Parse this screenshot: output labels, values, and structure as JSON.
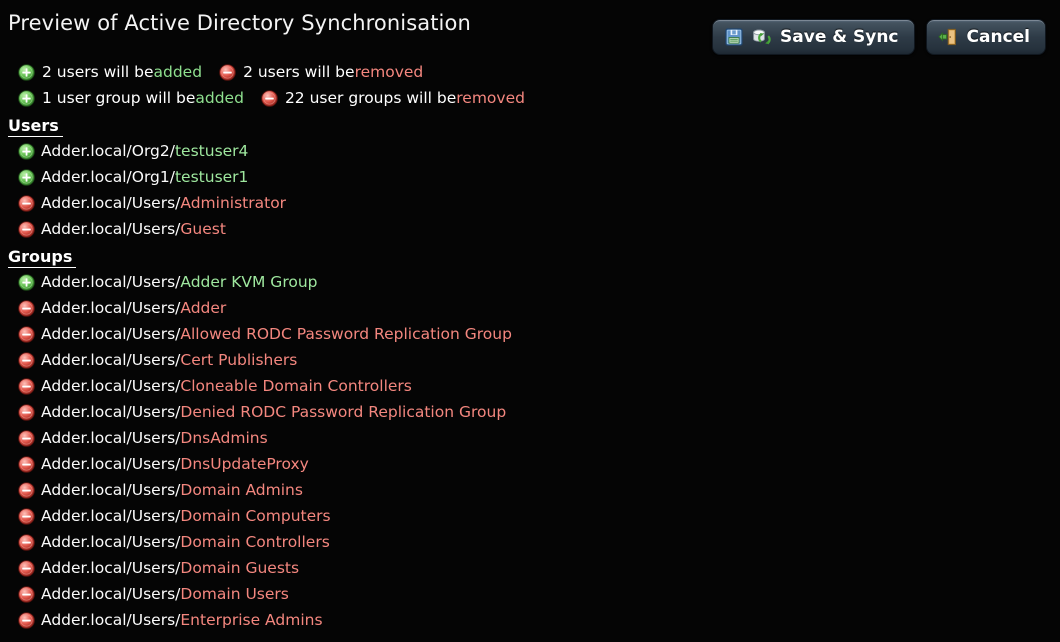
{
  "window": {
    "background_color": "#050505",
    "title": "Preview of Active Directory Synchronisation"
  },
  "colors": {
    "added": "#9fe89f",
    "removed": "#f4877f",
    "text": "#fbfbfb",
    "button_face": "#2e3b47"
  },
  "header": {
    "title": "Preview of Active Directory Synchronisation",
    "buttons": [
      {
        "label": "Save & Sync",
        "name": "save-and-sync-button",
        "icons": [
          "save-floppy-icon",
          "sync-refresh-icon"
        ]
      },
      {
        "label": "Cancel",
        "name": "cancel-button",
        "icons": [
          "exit-door-icon"
        ]
      }
    ]
  },
  "summary": {
    "lines": [
      [
        {
          "icon": "plus-circle-icon",
          "kind": "add",
          "prefix": "2 users will be ",
          "keyword": "added"
        },
        {
          "icon": "minus-circle-icon",
          "kind": "del",
          "prefix": "2 users will be ",
          "keyword": "removed"
        }
      ],
      [
        {
          "icon": "plus-circle-icon",
          "kind": "add",
          "prefix": "1 user group will be ",
          "keyword": "added"
        },
        {
          "icon": "minus-circle-icon",
          "kind": "del",
          "prefix": "22 user groups will be ",
          "keyword": "removed"
        }
      ]
    ]
  },
  "sections": [
    {
      "title": "Users",
      "name": "users-section",
      "rows": [
        {
          "kind": "add",
          "path": "Adder.local/Org2/",
          "name": "testuser4"
        },
        {
          "kind": "add",
          "path": "Adder.local/Org1/",
          "name": "testuser1"
        },
        {
          "kind": "del",
          "path": "Adder.local/Users/",
          "name": "Administrator"
        },
        {
          "kind": "del",
          "path": "Adder.local/Users/",
          "name": "Guest"
        }
      ]
    },
    {
      "title": "Groups",
      "name": "groups-section",
      "rows": [
        {
          "kind": "add",
          "path": "Adder.local/Users/",
          "name": "Adder KVM Group"
        },
        {
          "kind": "del",
          "path": "Adder.local/Users/",
          "name": "Adder"
        },
        {
          "kind": "del",
          "path": "Adder.local/Users/",
          "name": "Allowed RODC Password Replication Group"
        },
        {
          "kind": "del",
          "path": "Adder.local/Users/",
          "name": "Cert Publishers"
        },
        {
          "kind": "del",
          "path": "Adder.local/Users/",
          "name": "Cloneable Domain Controllers"
        },
        {
          "kind": "del",
          "path": "Adder.local/Users/",
          "name": "Denied RODC Password Replication Group"
        },
        {
          "kind": "del",
          "path": "Adder.local/Users/",
          "name": "DnsAdmins"
        },
        {
          "kind": "del",
          "path": "Adder.local/Users/",
          "name": "DnsUpdateProxy"
        },
        {
          "kind": "del",
          "path": "Adder.local/Users/",
          "name": "Domain Admins"
        },
        {
          "kind": "del",
          "path": "Adder.local/Users/",
          "name": "Domain Computers"
        },
        {
          "kind": "del",
          "path": "Adder.local/Users/",
          "name": "Domain Controllers"
        },
        {
          "kind": "del",
          "path": "Adder.local/Users/",
          "name": "Domain Guests"
        },
        {
          "kind": "del",
          "path": "Adder.local/Users/",
          "name": "Domain Users"
        },
        {
          "kind": "del",
          "path": "Adder.local/Users/",
          "name": "Enterprise Admins"
        }
      ]
    }
  ]
}
